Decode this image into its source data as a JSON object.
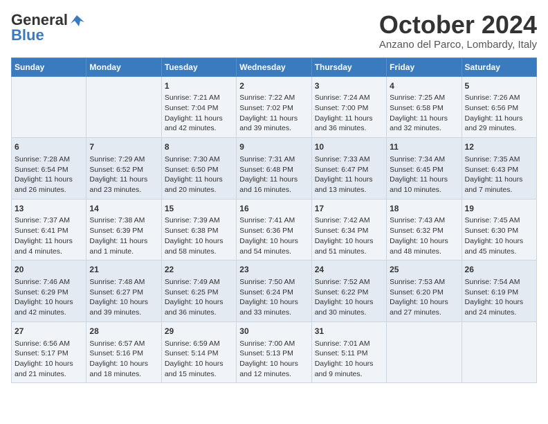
{
  "header": {
    "logo_line1": "General",
    "logo_line2": "Blue",
    "month": "October 2024",
    "location": "Anzano del Parco, Lombardy, Italy"
  },
  "days_of_week": [
    "Sunday",
    "Monday",
    "Tuesday",
    "Wednesday",
    "Thursday",
    "Friday",
    "Saturday"
  ],
  "weeks": [
    [
      {
        "day": "",
        "info": ""
      },
      {
        "day": "",
        "info": ""
      },
      {
        "day": "1",
        "info": "Sunrise: 7:21 AM\nSunset: 7:04 PM\nDaylight: 11 hours and 42 minutes."
      },
      {
        "day": "2",
        "info": "Sunrise: 7:22 AM\nSunset: 7:02 PM\nDaylight: 11 hours and 39 minutes."
      },
      {
        "day": "3",
        "info": "Sunrise: 7:24 AM\nSunset: 7:00 PM\nDaylight: 11 hours and 36 minutes."
      },
      {
        "day": "4",
        "info": "Sunrise: 7:25 AM\nSunset: 6:58 PM\nDaylight: 11 hours and 32 minutes."
      },
      {
        "day": "5",
        "info": "Sunrise: 7:26 AM\nSunset: 6:56 PM\nDaylight: 11 hours and 29 minutes."
      }
    ],
    [
      {
        "day": "6",
        "info": "Sunrise: 7:28 AM\nSunset: 6:54 PM\nDaylight: 11 hours and 26 minutes."
      },
      {
        "day": "7",
        "info": "Sunrise: 7:29 AM\nSunset: 6:52 PM\nDaylight: 11 hours and 23 minutes."
      },
      {
        "day": "8",
        "info": "Sunrise: 7:30 AM\nSunset: 6:50 PM\nDaylight: 11 hours and 20 minutes."
      },
      {
        "day": "9",
        "info": "Sunrise: 7:31 AM\nSunset: 6:48 PM\nDaylight: 11 hours and 16 minutes."
      },
      {
        "day": "10",
        "info": "Sunrise: 7:33 AM\nSunset: 6:47 PM\nDaylight: 11 hours and 13 minutes."
      },
      {
        "day": "11",
        "info": "Sunrise: 7:34 AM\nSunset: 6:45 PM\nDaylight: 11 hours and 10 minutes."
      },
      {
        "day": "12",
        "info": "Sunrise: 7:35 AM\nSunset: 6:43 PM\nDaylight: 11 hours and 7 minutes."
      }
    ],
    [
      {
        "day": "13",
        "info": "Sunrise: 7:37 AM\nSunset: 6:41 PM\nDaylight: 11 hours and 4 minutes."
      },
      {
        "day": "14",
        "info": "Sunrise: 7:38 AM\nSunset: 6:39 PM\nDaylight: 11 hours and 1 minute."
      },
      {
        "day": "15",
        "info": "Sunrise: 7:39 AM\nSunset: 6:38 PM\nDaylight: 10 hours and 58 minutes."
      },
      {
        "day": "16",
        "info": "Sunrise: 7:41 AM\nSunset: 6:36 PM\nDaylight: 10 hours and 54 minutes."
      },
      {
        "day": "17",
        "info": "Sunrise: 7:42 AM\nSunset: 6:34 PM\nDaylight: 10 hours and 51 minutes."
      },
      {
        "day": "18",
        "info": "Sunrise: 7:43 AM\nSunset: 6:32 PM\nDaylight: 10 hours and 48 minutes."
      },
      {
        "day": "19",
        "info": "Sunrise: 7:45 AM\nSunset: 6:30 PM\nDaylight: 10 hours and 45 minutes."
      }
    ],
    [
      {
        "day": "20",
        "info": "Sunrise: 7:46 AM\nSunset: 6:29 PM\nDaylight: 10 hours and 42 minutes."
      },
      {
        "day": "21",
        "info": "Sunrise: 7:48 AM\nSunset: 6:27 PM\nDaylight: 10 hours and 39 minutes."
      },
      {
        "day": "22",
        "info": "Sunrise: 7:49 AM\nSunset: 6:25 PM\nDaylight: 10 hours and 36 minutes."
      },
      {
        "day": "23",
        "info": "Sunrise: 7:50 AM\nSunset: 6:24 PM\nDaylight: 10 hours and 33 minutes."
      },
      {
        "day": "24",
        "info": "Sunrise: 7:52 AM\nSunset: 6:22 PM\nDaylight: 10 hours and 30 minutes."
      },
      {
        "day": "25",
        "info": "Sunrise: 7:53 AM\nSunset: 6:20 PM\nDaylight: 10 hours and 27 minutes."
      },
      {
        "day": "26",
        "info": "Sunrise: 7:54 AM\nSunset: 6:19 PM\nDaylight: 10 hours and 24 minutes."
      }
    ],
    [
      {
        "day": "27",
        "info": "Sunrise: 6:56 AM\nSunset: 5:17 PM\nDaylight: 10 hours and 21 minutes."
      },
      {
        "day": "28",
        "info": "Sunrise: 6:57 AM\nSunset: 5:16 PM\nDaylight: 10 hours and 18 minutes."
      },
      {
        "day": "29",
        "info": "Sunrise: 6:59 AM\nSunset: 5:14 PM\nDaylight: 10 hours and 15 minutes."
      },
      {
        "day": "30",
        "info": "Sunrise: 7:00 AM\nSunset: 5:13 PM\nDaylight: 10 hours and 12 minutes."
      },
      {
        "day": "31",
        "info": "Sunrise: 7:01 AM\nSunset: 5:11 PM\nDaylight: 10 hours and 9 minutes."
      },
      {
        "day": "",
        "info": ""
      },
      {
        "day": "",
        "info": ""
      }
    ]
  ]
}
